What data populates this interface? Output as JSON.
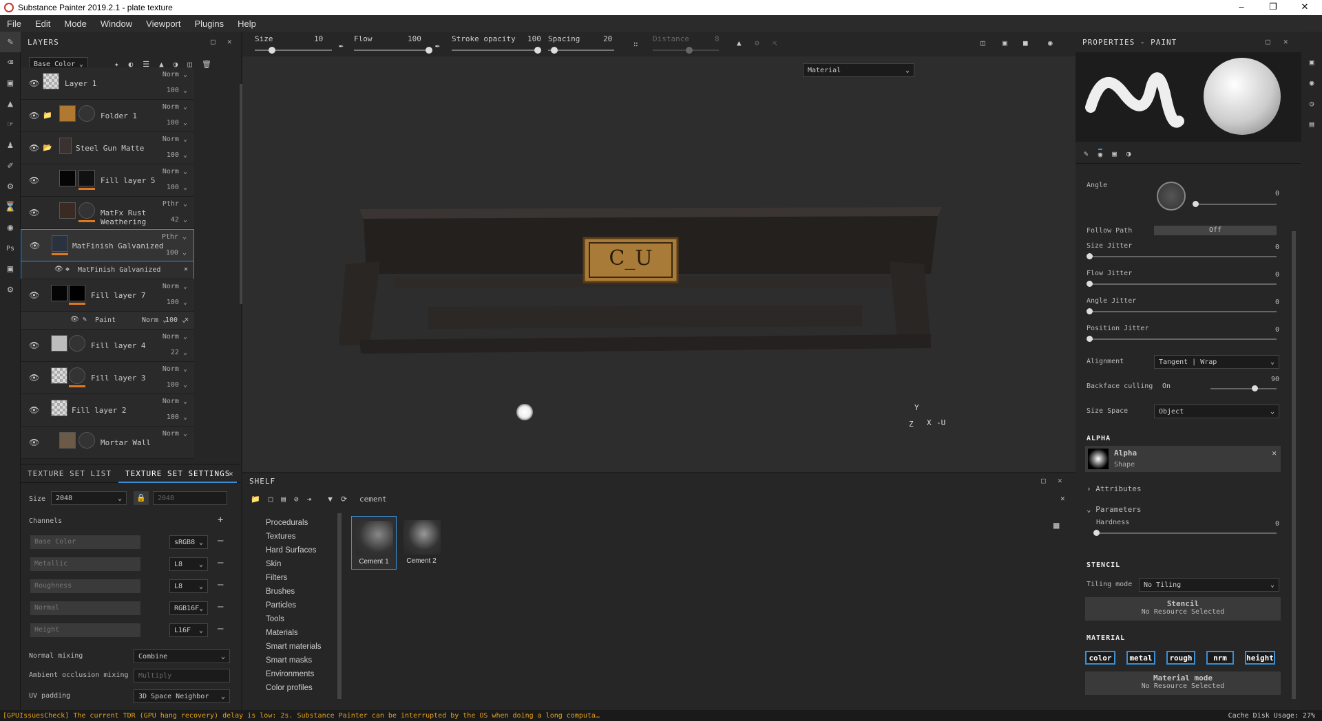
{
  "title": "Substance Painter 2019.2.1 - plate texture",
  "menu": [
    "File",
    "Edit",
    "Mode",
    "Window",
    "Viewport",
    "Plugins",
    "Help"
  ],
  "layers_panel": {
    "title": "LAYERS",
    "channel": "Base Color",
    "layers": [
      {
        "name": "Layer 1",
        "blend": "Norm",
        "opacity": "100"
      },
      {
        "name": "Folder 1",
        "blend": "Norm",
        "opacity": "100"
      },
      {
        "name": "Steel Gun Matte",
        "blend": "Norm",
        "opacity": "100"
      },
      {
        "name": "Fill layer 5",
        "blend": "Norm",
        "opacity": "100"
      },
      {
        "name": "MatFx Rust Weathering",
        "blend": "Pthr",
        "opacity": "42"
      },
      {
        "name": "MatFinish Galvanized",
        "blend": "Pthr",
        "opacity": "100"
      },
      {
        "name": "Fill layer 7",
        "blend": "Norm",
        "opacity": "100"
      },
      {
        "name": "Fill layer 4",
        "blend": "Norm",
        "opacity": "22"
      },
      {
        "name": "Fill layer 3",
        "blend": "Norm",
        "opacity": "100"
      },
      {
        "name": "Fill layer 2",
        "blend": "Norm",
        "opacity": "100"
      },
      {
        "name": "Mortar Wall",
        "blend": "Norm",
        "opacity": ""
      }
    ],
    "effect_filter": "MatFinish Galvanized",
    "paint_effect": {
      "name": "Paint",
      "blend": "Norm",
      "opacity": "100"
    }
  },
  "texture_settings": {
    "tab_list": "TEXTURE SET LIST",
    "tab_settings": "TEXTURE SET SETTINGS",
    "size_label": "Size",
    "size": "2048",
    "size2": "2048",
    "channels_label": "Channels",
    "channels": [
      {
        "name": "Base Color",
        "format": "sRGB8"
      },
      {
        "name": "Metallic",
        "format": "L8"
      },
      {
        "name": "Roughness",
        "format": "L8"
      },
      {
        "name": "Normal",
        "format": "RGB16F"
      },
      {
        "name": "Height",
        "format": "L16F"
      }
    ],
    "normal_mixing_label": "Normal mixing",
    "normal_mixing": "Combine",
    "ao_mixing_label": "Ambient occlusion mixing",
    "ao_mixing": "Multiply",
    "uv_padding_label": "UV padding",
    "uv_padding": "3D Space Neighbor"
  },
  "toolbar": {
    "size_label": "Size",
    "size": "10",
    "flow_label": "Flow",
    "flow": "100",
    "stroke_label": "Stroke opacity",
    "stroke": "100",
    "spacing_label": "Spacing",
    "spacing": "20",
    "distance_label": "Distance",
    "distance": "8"
  },
  "viewport": {
    "mode": "Material",
    "plate_text": "C_U",
    "axis_y": "Y",
    "axis_x": "X",
    "axis_z": "Z",
    "axis_u": "-U"
  },
  "shelf": {
    "title": "SHELF",
    "search": "cement",
    "categories": [
      "Procedurals",
      "Textures",
      "Hard Surfaces",
      "Skin",
      "Filters",
      "Brushes",
      "Particles",
      "Tools",
      "Materials",
      "Smart materials",
      "Smart masks",
      "Environments",
      "Color profiles"
    ],
    "items": [
      "Cement 1",
      "Cement 2"
    ]
  },
  "properties": {
    "title": "PROPERTIES - PAINT",
    "angle_label": "Angle",
    "angle": "0",
    "follow_path_label": "Follow Path",
    "follow_path": "Off",
    "size_jitter_label": "Size Jitter",
    "size_jitter": "0",
    "flow_jitter_label": "Flow Jitter",
    "flow_jitter": "0",
    "angle_jitter_label": "Angle Jitter",
    "angle_jitter": "0",
    "position_jitter_label": "Position Jitter",
    "position_jitter": "0",
    "alignment_label": "Alignment",
    "alignment": "Tangent | Wrap",
    "backface_label": "Backface culling",
    "backface": "On",
    "backface_value": "90",
    "size_space_label": "Size Space",
    "size_space": "Object",
    "alpha_section": "ALPHA",
    "alpha_name": "Alpha",
    "alpha_type": "Shape",
    "attributes": "Attributes",
    "parameters": "Parameters",
    "hardness_label": "Hardness",
    "hardness": "0",
    "stencil_section": "STENCIL",
    "tiling_label": "Tiling mode",
    "tiling": "No Tiling",
    "stencil_title": "Stencil",
    "stencil_none": "No Resource Selected",
    "material_section": "MATERIAL",
    "chips": [
      "color",
      "metal",
      "rough",
      "nrm",
      "height"
    ],
    "material_mode": "Material mode",
    "material_none": "No Resource Selected"
  },
  "status": {
    "message": "[GPUIssuesCheck] The current TDR (GPU hang recovery) delay is low: 2s. Substance Painter can be interrupted by the OS when doing a long computa…",
    "cache": "Cache Disk Usage:   27%"
  },
  "colors": {
    "accent": "#3a8fd6",
    "orange": "#e07820",
    "warning": "#e0a020"
  }
}
